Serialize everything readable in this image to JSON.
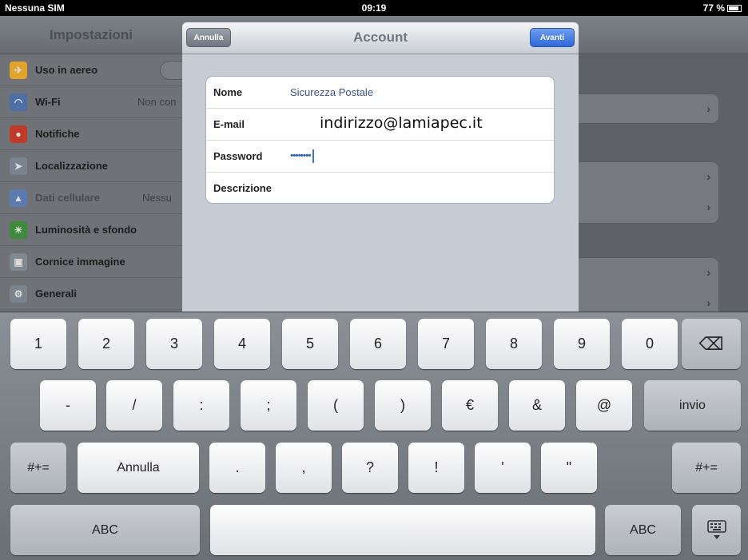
{
  "status_bar": {
    "carrier": "Nessuna SIM",
    "time": "09:19",
    "battery": "77 %"
  },
  "settings": {
    "title": "Impostazioni",
    "items": [
      {
        "label": "Uso in aereo",
        "value": "",
        "icon": "airplane-icon",
        "color": "#e1a32a"
      },
      {
        "label": "Wi-Fi",
        "value": "Non con",
        "icon": "wifi-icon",
        "color": "#4d6fa6"
      },
      {
        "label": "Notifiche",
        "value": "",
        "icon": "notifications-icon",
        "color": "#c0392b"
      },
      {
        "label": "Localizzazione",
        "value": "",
        "icon": "location-icon",
        "color": "#7a8490"
      },
      {
        "label": "Dati cellulare",
        "value": "Nessu",
        "icon": "cellular-icon",
        "color": "#5b7bb0"
      },
      {
        "label": "Luminosità e sfondo",
        "value": "",
        "icon": "brightness-icon",
        "color": "#3f8a3b"
      },
      {
        "label": "Cornice immagine",
        "value": "",
        "icon": "picture-frame-icon",
        "color": "#808890"
      },
      {
        "label": "Generali",
        "value": "",
        "icon": "gear-icon",
        "color": "#7b838c"
      }
    ]
  },
  "sheet": {
    "title": "Account",
    "cancel_label": "Annulla",
    "next_label": "Avanti",
    "fields": {
      "nome_label": "Nome",
      "nome_value": "Sicurezza Postale",
      "email_label": "E-mail",
      "email_value": "indirizzo@lamiapec.it",
      "password_label": "Password",
      "password_value": "••••••••",
      "descrizione_label": "Descrizione",
      "descrizione_value": ""
    }
  },
  "keyboard": {
    "row1": [
      "1",
      "2",
      "3",
      "4",
      "5",
      "6",
      "7",
      "8",
      "9",
      "0"
    ],
    "backspace": "⌫",
    "row2": [
      "-",
      "/",
      ":",
      ";",
      "(",
      ")",
      "€",
      "&",
      "@"
    ],
    "return_label": "invio",
    "row3_left": "#+=",
    "undo_label": "Annulla",
    "row3": [
      ".",
      ",",
      "?",
      "!",
      "'",
      "\""
    ],
    "row3_right": "#+=",
    "abc_left": "ABC",
    "space": "",
    "abc_right": "ABC",
    "hide_keyboard_icon": "keyboard-hide-icon"
  }
}
